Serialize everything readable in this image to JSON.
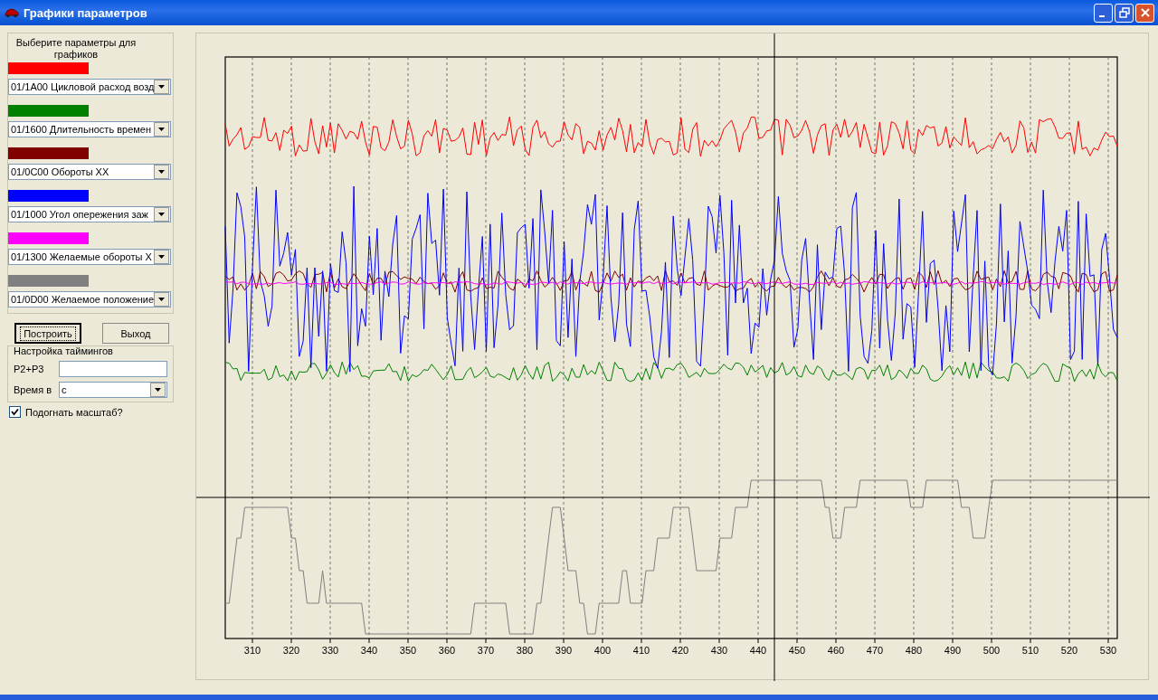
{
  "window": {
    "title": "Графики параметров"
  },
  "parameters_group": {
    "title": "Выберите параметры для графиков",
    "items": [
      {
        "color": "#ff0000",
        "value": "01/1A00 Цикловой расход возд"
      },
      {
        "color": "#008000",
        "value": "01/1600 Длительность времен"
      },
      {
        "color": "#800000",
        "value": "01/0C00 Обороты ХХ"
      },
      {
        "color": "#0000ff",
        "value": "01/1000 Угол опережения заж"
      },
      {
        "color": "#ff00ff",
        "value": "01/1300 Желаемые обороты Х"
      },
      {
        "color": "#808080",
        "value": "01/0D00 Желаемое положение"
      }
    ]
  },
  "buttons": [
    {
      "label": "Построить",
      "focused": true
    },
    {
      "label": "Выход",
      "focused": false
    }
  ],
  "timing_group": {
    "title": "Настройка таймингов",
    "p2p3_label": "P2+P3",
    "time_label": "Время в",
    "time_value": "с"
  },
  "autoscale": {
    "label": "Подогнать масштаб?",
    "checked": true
  },
  "x_axis_labels": [
    "310",
    "320",
    "330",
    "340",
    "350",
    "360",
    "370",
    "380",
    "390",
    "400",
    "410",
    "420",
    "430",
    "440",
    "450",
    "460",
    "470",
    "480",
    "490",
    "500",
    "510",
    "520",
    "530"
  ]
}
